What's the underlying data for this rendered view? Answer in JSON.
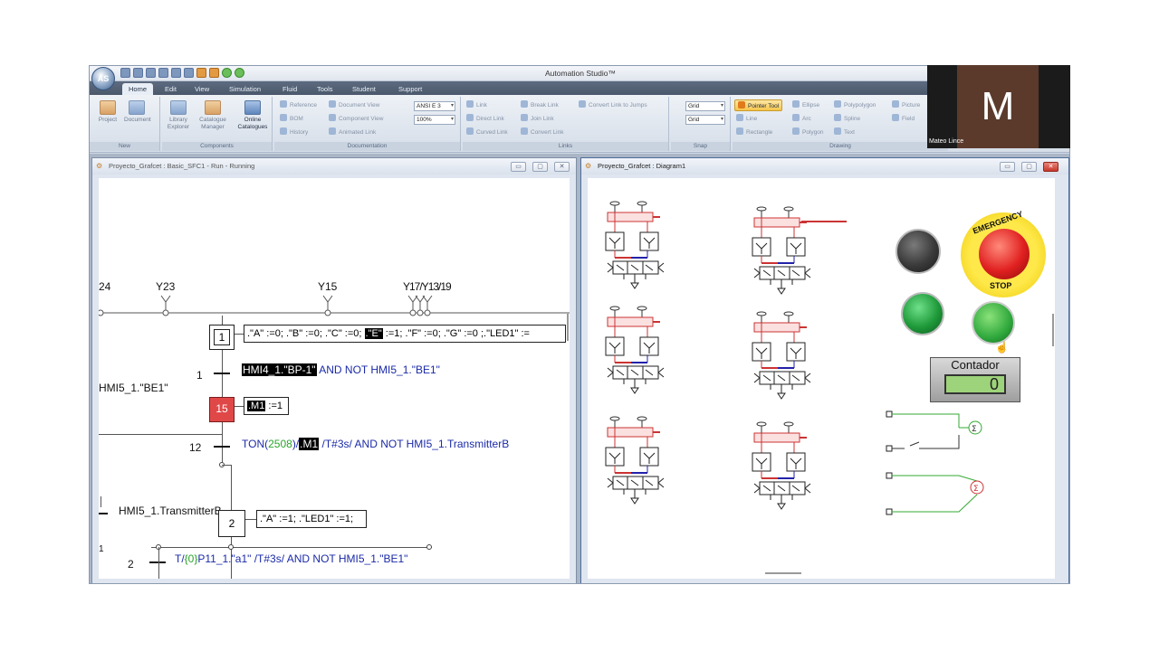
{
  "app": {
    "title": "Automation Studio™",
    "orb_label": "AS",
    "tabs": [
      "Home",
      "Edit",
      "View",
      "Simulation",
      "Fluid",
      "Tools",
      "Student",
      "Support"
    ]
  },
  "ribbon": {
    "new_group": {
      "label": "New",
      "project": "Project",
      "document": "Document"
    },
    "components_group": {
      "label": "Components",
      "library_explorer": "Library Explorer",
      "catalogue_manager": "Catalogue Manager",
      "online_catalogues": "Online Catalogues"
    },
    "documentation_group": {
      "label": "Documentation",
      "reference": "Reference",
      "bom": "BOM",
      "history": "History",
      "document_view": "Document View",
      "component_view": "Component View",
      "animated_link": "Animated Link",
      "standard_value": "ANSI E 3",
      "zoom_value": "100%"
    },
    "links_group": {
      "label": "Links",
      "link": "Link",
      "direct_link": "Direct Link",
      "curved_link": "Curved Link",
      "break_link": "Break Link",
      "join_link": "Join Link",
      "convert_link": "Convert Link",
      "convert_link_to_jumps": "Convert Link to Jumps"
    },
    "snap_group": {
      "label": "Snap",
      "grid1": "Grid",
      "grid2": "Grid"
    },
    "drawing_group": {
      "label": "Drawing",
      "pointer_tool": "Pointer Tool",
      "line": "Line",
      "rectangle": "Rectangle",
      "ellipse": "Ellipse",
      "arc": "Arc",
      "polygon": "Polygon",
      "polypolygon": "Polypolygon",
      "spline": "Spline",
      "text": "Text",
      "picture": "Picture",
      "field": "Field"
    }
  },
  "left_window": {
    "title": "Proyecto_Grafcet : Basic_SFC1 - Run - Running",
    "outputs": [
      "24",
      "Y23",
      "Y15",
      "Y17/Y13/19"
    ],
    "step1": {
      "number": "1",
      "action_parts": [
        ".\"A\" :=0; .\"B\" :=0; .\"C\" :=0; ",
        ".\"E\"",
        " :=1; .\"F\" :=0; .\"G\" :=0 ;.\"LED1\" :="
      ]
    },
    "trans1": {
      "number": "1",
      "hl": "HMI4_1.\"BP-1\"",
      "rest": " AND NOT HMI5_1.\"BE1\""
    },
    "side_label1": "HMI5_1.\"BE1\"",
    "step15": {
      "number": "15",
      "action_hl": ".M1",
      "action_rest": " :=1"
    },
    "trans12": {
      "number": "12",
      "prefix": "TON(",
      "param": "2508",
      "close": ")/",
      "hl": ".M1",
      "rest": " /T#3s/ AND NOT HMI5_1.TransmitterB"
    },
    "side_label2": "HMI5_1.TransmitterB",
    "step2": {
      "number": "2",
      "action": ".\"A\" :=1; .\"LED1\" :=1;"
    },
    "trans2": {
      "number": "2",
      "prefix": "T/",
      "param": "{0}",
      "rest": "P11_1.\"a1\" /T#3s/ AND NOT HMI5_1.\"BE1\""
    },
    "left_edge_digit": "1"
  },
  "right_window": {
    "title": "Proyecto_Grafcet : Diagram1",
    "estop_top": "EMERGENCY",
    "estop_bottom": "STOP",
    "counter_title": "Contador",
    "counter_value": "0"
  },
  "webcam": {
    "initial": "M",
    "name": "Mateo Lince"
  },
  "colors": {
    "step_active": "#e04848",
    "estop": "#e02020",
    "lamp_green": "#1f9a3a",
    "lamp_off": "#3a3a3a",
    "counter_lcd": "#9dd37a"
  }
}
